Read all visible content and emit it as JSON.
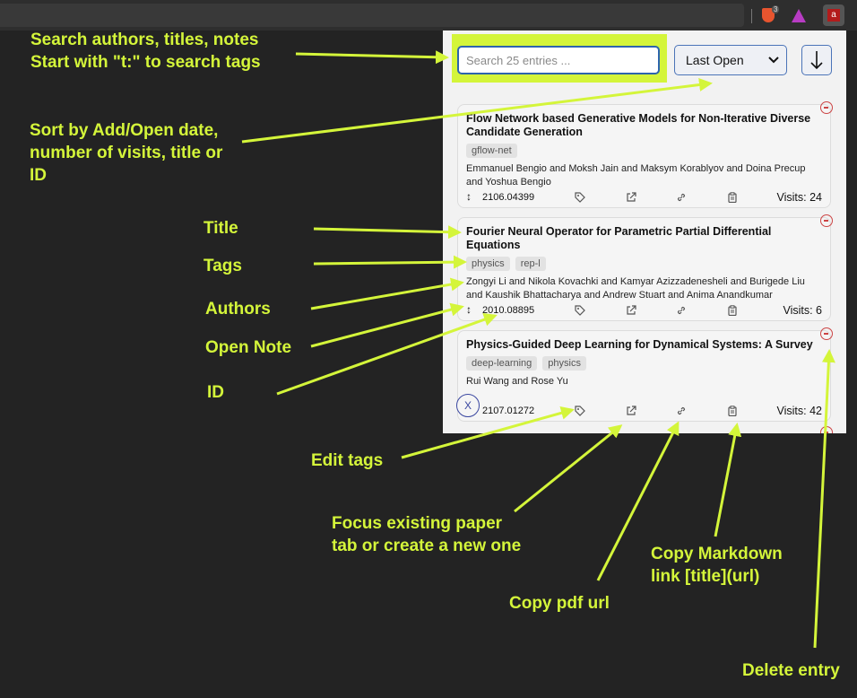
{
  "browser": {
    "extensions": [
      {
        "name": "brave-shields-icon",
        "badge": "3"
      },
      {
        "name": "brave-rewards-icon"
      },
      {
        "name": "arxiv-extension-icon",
        "label": "a"
      }
    ]
  },
  "popup": {
    "search": {
      "placeholder": "Search 25 entries ..."
    },
    "sort": {
      "selected": "Last Open",
      "direction_icon": "arrow-down-icon"
    },
    "close_label": "X",
    "papers": [
      {
        "title": "Flow Network based Generative Models for Non-Iterative Diverse Candidate Generation",
        "tags": [
          "gflow-net"
        ],
        "authors": "Emmanuel Bengio and Moksh Jain and Maksym Korablyov and Doina Precup and Yoshua Bengio",
        "id": "2106.04399",
        "visits": "Visits: 24"
      },
      {
        "title": "Fourier Neural Operator for Parametric Partial Differential Equations",
        "tags": [
          "physics",
          "rep-l"
        ],
        "authors": "Zongyi Li and Nikola Kovachki and Kamyar Azizzadenesheli and Burigede Liu and Kaushik Bhattacharya and Andrew Stuart and Anima Anandkumar",
        "id": "2010.08895",
        "visits": "Visits: 6"
      },
      {
        "title": "Physics-Guided Deep Learning for Dynamical Systems: A Survey",
        "tags": [
          "deep-learning",
          "physics"
        ],
        "authors": "Rui Wang and Rose Yu",
        "id": "2107.01272",
        "visits": "Visits: 42"
      }
    ]
  },
  "annotations": {
    "search": [
      "Search authors, titles, notes",
      "Start with \"t:\" to search tags"
    ],
    "sort": [
      "Sort by Add/Open date,",
      "number of visits, title or",
      "ID"
    ],
    "title": "Title",
    "tags": "Tags",
    "authors": "Authors",
    "open_note": "Open Note",
    "id": "ID",
    "edit_tags": "Edit tags",
    "focus_tab": [
      "Focus existing paper",
      "tab or create a new one"
    ],
    "copy_pdf": "Copy pdf url",
    "copy_md": [
      "Copy Markdown",
      "link [title](url)"
    ],
    "delete": "Delete entry"
  },
  "colors": {
    "annotation": "#d4f53a",
    "background": "#232323",
    "accent": "#2d64ad",
    "delete": "#cc4444"
  }
}
